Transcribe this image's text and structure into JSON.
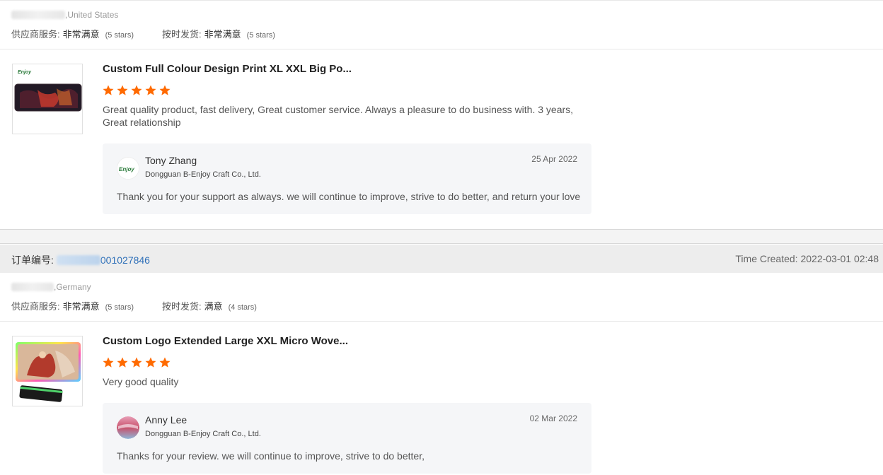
{
  "reviews": [
    {
      "buyer_country": ",United States",
      "supplier_service_label": "供应商服务:",
      "supplier_service_value": "非常满意",
      "supplier_service_stars": "(5 stars)",
      "on_time_label": "按时发货:",
      "on_time_value": "非常满意",
      "on_time_stars": "(5 stars)",
      "product_title": "Custom Full Colour Design Print XL XXL Big Po...",
      "rating": 5,
      "review_text": "Great quality product, fast delivery, Great customer service.  Always a pleasure to do business with. 3 years, Great relationship",
      "reply": {
        "name": "Tony Zhang",
        "company": "Dongguan B-Enjoy Craft Co., Ltd.",
        "date": "25 Apr 2022",
        "text": "Thank you for your support as always. we will continue to improve, strive to do better, and return your love",
        "avatar_icon": "b-enjoy-logo-icon"
      }
    },
    {
      "order_label": "订单编号:",
      "order_number_visible": "001027846",
      "time_created": "Time Created: 2022-03-01 02:48",
      "buyer_country": ",Germany",
      "supplier_service_label": "供应商服务:",
      "supplier_service_value": "非常满意",
      "supplier_service_stars": "(5 stars)",
      "on_time_label": "按时发货:",
      "on_time_value": "满意",
      "on_time_stars": "(4 stars)",
      "product_title": "Custom Logo Extended Large XXL Micro Wove...",
      "rating": 5,
      "review_text": "Very good quality",
      "reply": {
        "name": "Anny Lee",
        "company": "Dongguan B-Enjoy Craft Co., Ltd.",
        "date": "02 Mar 2022",
        "text": "Thanks for your review.  we will continue to improve, strive to do better,",
        "avatar_icon": "user-avatar-icon"
      }
    }
  ],
  "colors": {
    "star": "#ff6a00",
    "link": "#2d6fb8"
  }
}
